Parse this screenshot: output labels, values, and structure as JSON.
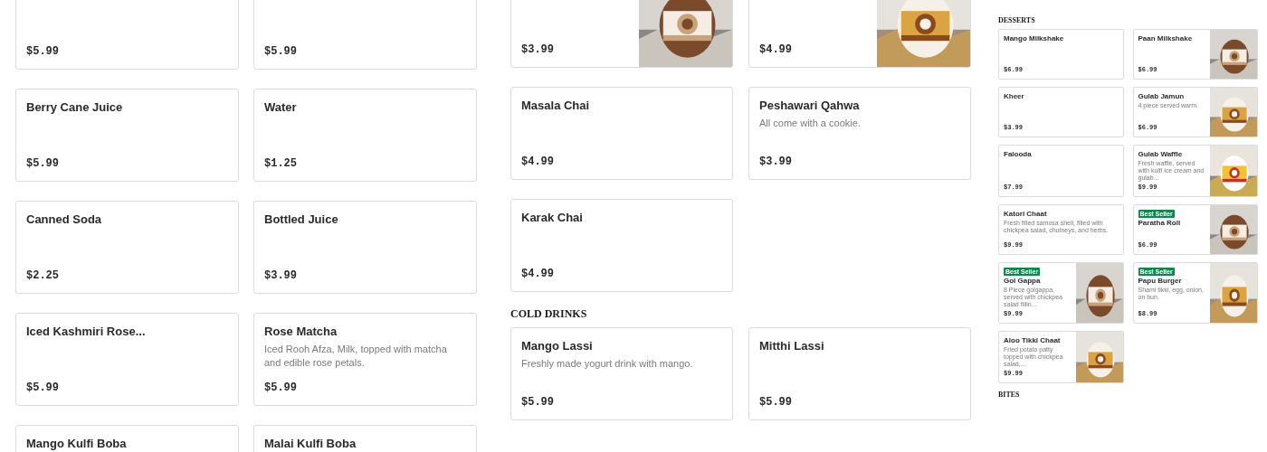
{
  "panels": [
    {
      "sections": [
        {
          "kind": "cards",
          "cards": [
            {
              "price": "$5.99"
            },
            {
              "price": "$5.99"
            }
          ]
        },
        {
          "kind": "cards",
          "cards": [
            {
              "title": "Berry Cane Juice",
              "price": "$5.99"
            },
            {
              "title": "Water",
              "price": "$1.25"
            }
          ]
        },
        {
          "kind": "cards",
          "cards": [
            {
              "title": "Canned Soda",
              "price": "$2.25"
            },
            {
              "title": "Bottled Juice",
              "price": "$3.99"
            }
          ]
        },
        {
          "kind": "cards",
          "cards": [
            {
              "title": "Iced Kashmiri Rose...",
              "price": "$5.99"
            },
            {
              "title": "Rose Matcha",
              "description": "Iced Rooh Afza, Milk, topped with matcha and edible rose petals.",
              "price": "$5.99"
            }
          ]
        },
        {
          "kind": "cards",
          "cards": [
            {
              "title": "Mango Kulfi Boba"
            },
            {
              "title": "Malai Kulfi Boba"
            }
          ]
        }
      ]
    },
    {
      "sections": [
        {
          "kind": "cards",
          "cards": [
            {
              "price": "$3.99",
              "photo": true
            },
            {
              "price": "$4.99",
              "photo": true
            }
          ]
        },
        {
          "kind": "cards",
          "cards": [
            {
              "title": "Masala Chai",
              "price": "$4.99"
            },
            {
              "title": "Peshawari Qahwa",
              "description": "All come with a cookie.",
              "price": "$3.99"
            }
          ]
        },
        {
          "kind": "cards",
          "cards": [
            {
              "title": "Karak Chai",
              "price": "$4.99"
            }
          ]
        },
        {
          "kind": "heading",
          "text": "COLD DRINKS"
        },
        {
          "kind": "cards",
          "cards": [
            {
              "title": "Mango Lassi",
              "description": "Freshly made yogurt drink with mango.",
              "price": "$5.99"
            },
            {
              "title": "Mitthi Lassi",
              "price": "$5.99"
            }
          ]
        }
      ]
    },
    {
      "sections": [
        {
          "kind": "heading",
          "text": "DESSERTS"
        },
        {
          "kind": "cards",
          "cards": [
            {
              "title": "Mango Milkshake",
              "price": "$6.99"
            },
            {
              "title": "Paan Milkshake",
              "price": "$6.99",
              "photo": true
            }
          ]
        },
        {
          "kind": "cards",
          "cards": [
            {
              "title": "Kheer",
              "price": "$3.99"
            },
            {
              "title": "Gulab Jamun",
              "description": "4 piece served warm.",
              "price": "$6.99",
              "photo": true
            }
          ]
        },
        {
          "kind": "cards",
          "cards": [
            {
              "title": "Falooda",
              "price": "$7.99"
            },
            {
              "title": "Gulab Waffle",
              "description": "Fresh waffle, served with kulfi ice cream and gulab...",
              "price": "$9.99",
              "photo": true
            }
          ]
        },
        {
          "kind": "cards",
          "cards": [
            {
              "title": "Katori Chaat",
              "description": "Fresh filled samosa shell, filled with chickpea salad, chutneys, and herbs.",
              "price": "$9.99"
            },
            {
              "badge": "Best Seller",
              "title": "Paratha Roll",
              "price": "$6.99",
              "photo": true
            }
          ]
        },
        {
          "kind": "cards",
          "cards": [
            {
              "badge": "Best Seller",
              "title": "Gol Gappa",
              "description": "8 Piece golgappa, served with chickpea salad fillin...",
              "price": "$9.99",
              "photo": true
            },
            {
              "badge": "Best Seller",
              "title": "Papu Burger",
              "description": "Shami tikki, egg, onion, on bun.",
              "price": "$8.99",
              "photo": true
            }
          ]
        },
        {
          "kind": "cards",
          "cards": [
            {
              "title": "Aloo Tikki Chaat",
              "description": "Fried potato patty topped with chickpea salad,...",
              "price": "$9.99",
              "photo": true
            }
          ]
        },
        {
          "kind": "heading",
          "text": "BITES"
        }
      ]
    }
  ]
}
